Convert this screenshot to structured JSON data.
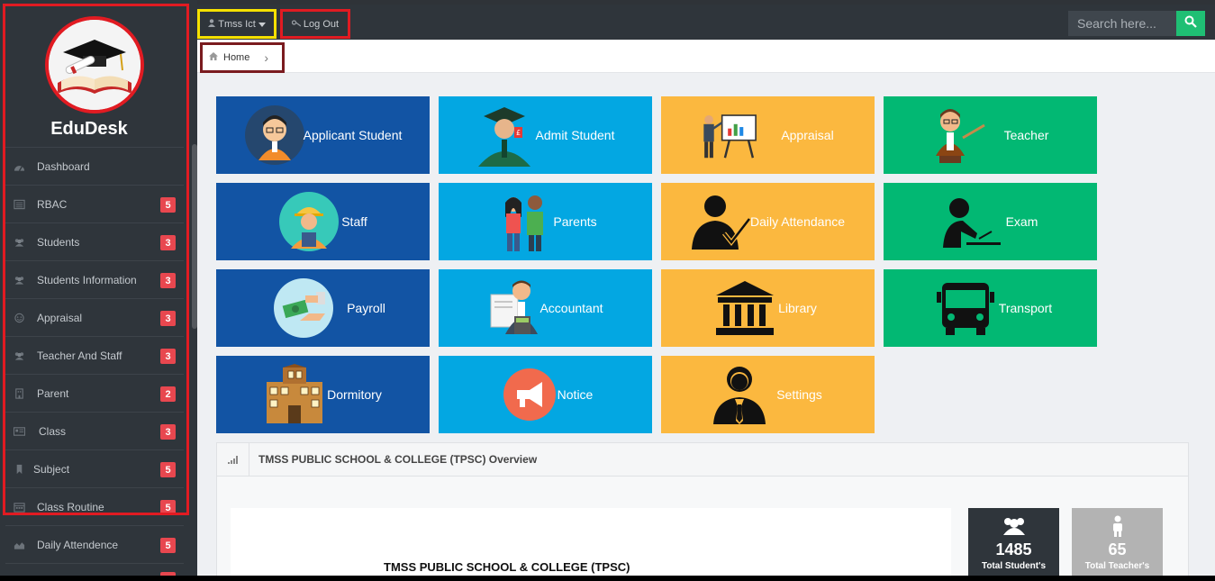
{
  "app": {
    "brand": "EduDesk"
  },
  "sidebar": {
    "items": [
      {
        "label": "Dashboard",
        "icon": "dashboard-icon",
        "badge": null
      },
      {
        "label": "RBAC",
        "icon": "list-icon",
        "badge": "5"
      },
      {
        "label": "Students",
        "icon": "users-icon",
        "badge": "3"
      },
      {
        "label": "Students Information",
        "icon": "users-icon",
        "badge": "3"
      },
      {
        "label": "Appraisal",
        "icon": "smile-icon",
        "badge": "3"
      },
      {
        "label": "Teacher And Staff",
        "icon": "users-icon",
        "badge": "3"
      },
      {
        "label": "Parent",
        "icon": "building-icon",
        "badge": "2"
      },
      {
        "label": "Class",
        "icon": "id-card-icon",
        "badge": "3"
      },
      {
        "label": "Subject",
        "icon": "bookmark-icon",
        "badge": "5"
      },
      {
        "label": "Class Routine",
        "icon": "calendar-icon",
        "badge": "5"
      },
      {
        "label": "Daily Attendence",
        "icon": "area-chart-icon",
        "badge": "5"
      }
    ]
  },
  "topbar": {
    "user_label": "Tmss Ict",
    "logout_label": "Log Out",
    "search_placeholder": "Search here..."
  },
  "breadcrumb": {
    "home": "Home"
  },
  "tiles": [
    {
      "label": "Applicant Student",
      "color": "#1254a4"
    },
    {
      "label": "Admit Student",
      "color": "#03a7e2"
    },
    {
      "label": "Appraisal",
      "color": "#fbb83f"
    },
    {
      "label": "Teacher",
      "color": "#02b873"
    },
    {
      "label": "Staff",
      "color": "#1254a4"
    },
    {
      "label": "Parents",
      "color": "#03a7e2"
    },
    {
      "label": "Daily Attendance",
      "color": "#fbb83f"
    },
    {
      "label": "Exam",
      "color": "#02b873"
    },
    {
      "label": "Payroll",
      "color": "#1254a4"
    },
    {
      "label": "Accountant",
      "color": "#03a7e2"
    },
    {
      "label": "Library",
      "color": "#fbb83f"
    },
    {
      "label": "Transport",
      "color": "#02b873"
    },
    {
      "label": "Dormitory",
      "color": "#1254a4"
    },
    {
      "label": "Notice",
      "color": "#03a7e2"
    },
    {
      "label": "Settings",
      "color": "#fbb83f"
    }
  ],
  "overview": {
    "title": "TMSS PUBLIC SCHOOL & COLLEGE (TPSC) Overview",
    "school_name": "TMSS PUBLIC SCHOOL & COLLEGE (TPSC)",
    "stats": [
      {
        "value": "1485",
        "label": "Total Student's",
        "color": "#2f353b"
      },
      {
        "value": "65",
        "label": "Total Teacher's",
        "color": "#b3b3b3"
      }
    ]
  }
}
